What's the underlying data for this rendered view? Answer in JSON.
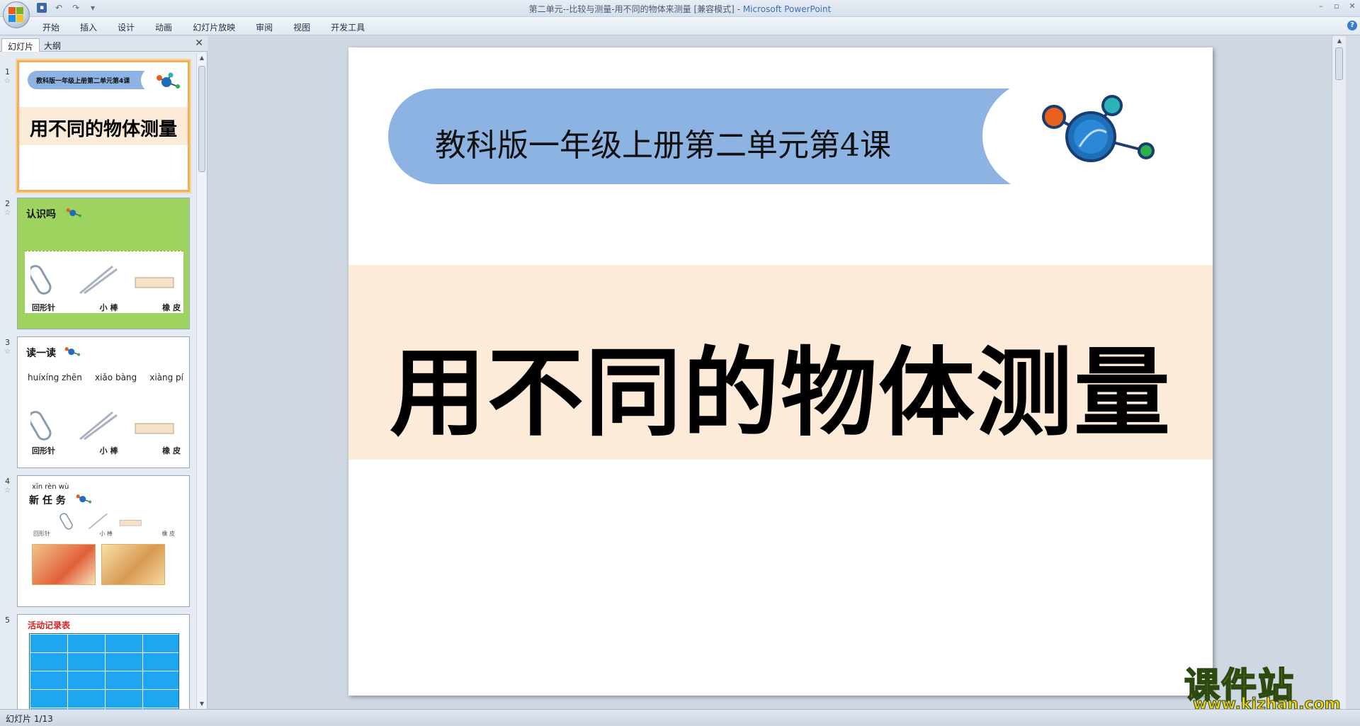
{
  "window": {
    "title_doc": "第二单元--比较与测量-用不同的物体来测量 [兼容模式] - ",
    "title_app": "Microsoft PowerPoint"
  },
  "ribbon": {
    "tabs": [
      "开始",
      "插入",
      "设计",
      "动画",
      "幻灯片放映",
      "审阅",
      "视图",
      "开发工具"
    ]
  },
  "left_pane": {
    "tab_slides": "幻灯片",
    "tab_outline": "大纲",
    "thumbnails": [
      {
        "num": "1",
        "header": "教科版一年级上册第二单元第4课",
        "title": "用不同的物体测量"
      },
      {
        "num": "2",
        "title": "认识吗",
        "items": [
          "回形针",
          "小 棒",
          "橡 皮"
        ]
      },
      {
        "num": "3",
        "title": "读一读",
        "pinyin": [
          "huíxíng zhēn",
          "xiǎo bàng",
          "xiàng pí"
        ],
        "items": [
          "回形针",
          "小 棒",
          "橡 皮"
        ]
      },
      {
        "num": "4",
        "pinyin": "xīn rèn wù",
        "title": "新 任 务",
        "items": [
          "回形针",
          "小 棒",
          "橡 皮"
        ]
      },
      {
        "num": "5",
        "title": "活动记录表"
      }
    ]
  },
  "slide": {
    "header": "教科版一年级上册第二单元第4课",
    "title": "用不同的物体测量"
  },
  "status": {
    "slide_indicator": "幻灯片 1/13"
  },
  "watermark": {
    "cn": "课件站",
    "url": "www.kjzhan.com"
  },
  "colors": {
    "banner": "#8db3e2",
    "title_band": "#fdebd9",
    "selection": "#f2b05a"
  }
}
